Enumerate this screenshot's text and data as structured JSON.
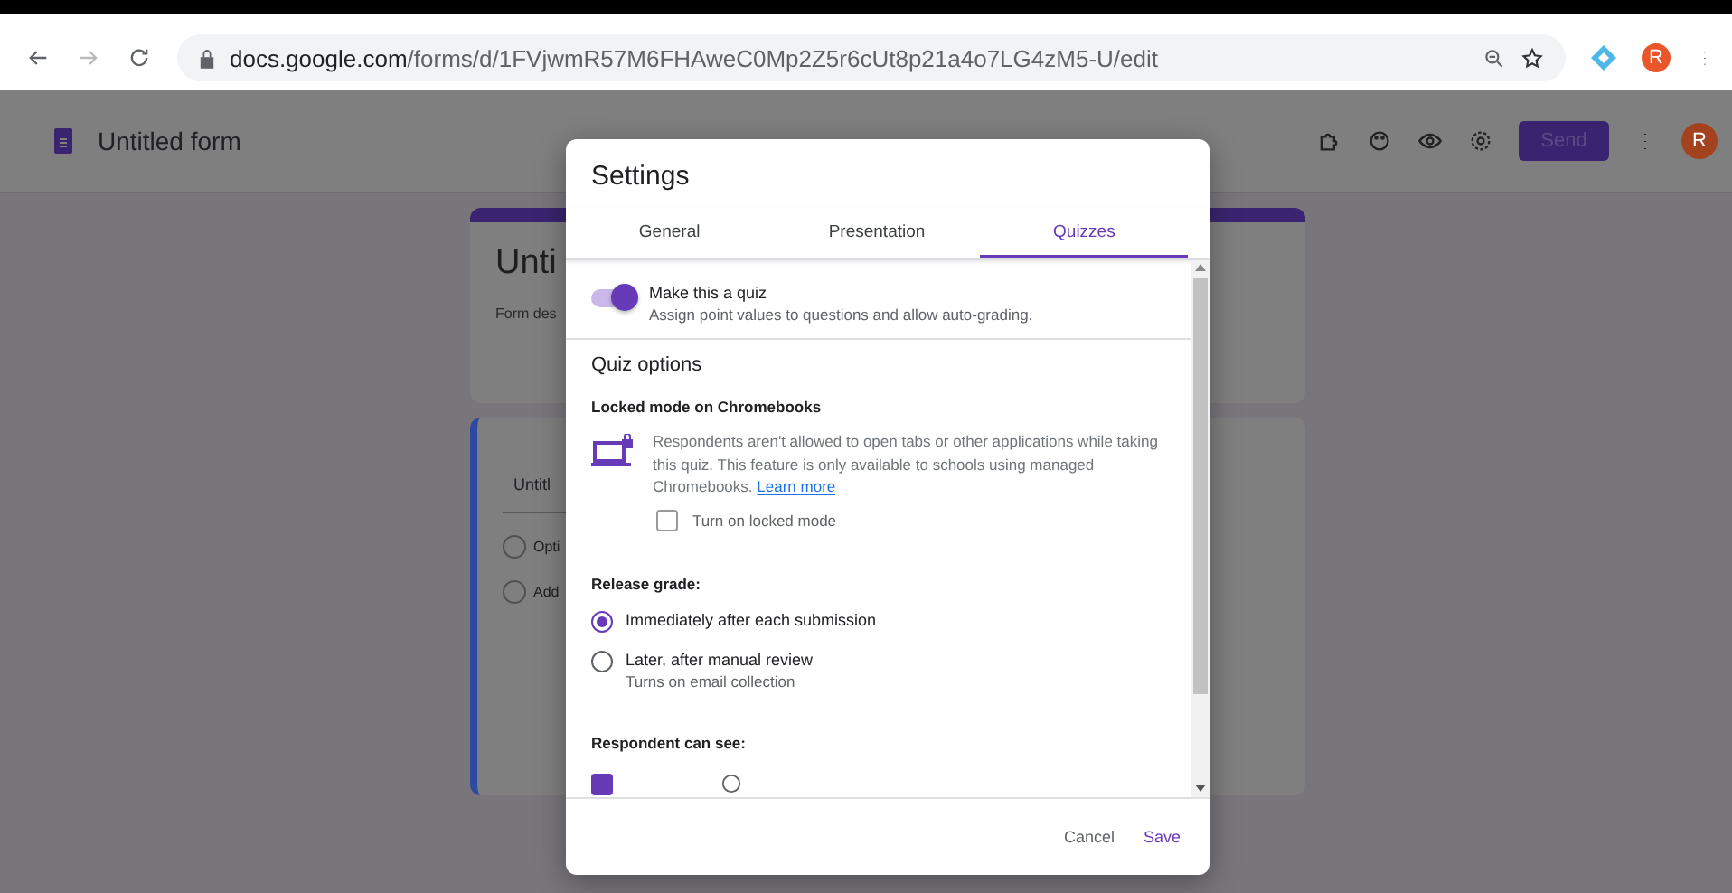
{
  "browser": {
    "url_host": "docs.google.com",
    "url_path": "/forms/d/1FVjwmR57M6FHAweC0Mp2Z5r6cUt8p21a4o7LG4zM5-U/edit",
    "profile_initial": "R"
  },
  "app": {
    "title": "Untitled form",
    "send": "Send",
    "avatar": "R"
  },
  "form": {
    "title": "Unti",
    "description": "Form des",
    "question": "Untitl",
    "options": [
      {
        "label": "Opti"
      },
      {
        "label": "Add"
      }
    ]
  },
  "settings": {
    "title": "Settings",
    "tabs": [
      {
        "label": "General",
        "selected": false
      },
      {
        "label": "Presentation",
        "selected": false
      },
      {
        "label": "Quizzes",
        "selected": true
      }
    ],
    "quiz_toggle": {
      "label": "Make this a quiz",
      "description": "Assign point values to questions and allow auto-grading.",
      "on": true
    },
    "section": "Quiz options",
    "locked": {
      "heading": "Locked mode on Chromebooks",
      "text": "Respondents aren't allowed to open tabs or other applications while taking this quiz. This feature is only available to schools using managed Chromebooks.",
      "link": "Learn more",
      "checkbox": {
        "label": "Turn on locked mode",
        "checked": false
      }
    },
    "release": {
      "heading": "Release grade:",
      "options": [
        {
          "label": "Immediately after each submission",
          "selected": true
        },
        {
          "label": "Later, after manual review",
          "sublabel": "Turns on email collection",
          "selected": false
        }
      ]
    },
    "respondent": {
      "heading": "Respondent can see:",
      "items": [
        {
          "checked": true
        }
      ]
    },
    "buttons": {
      "cancel": "Cancel",
      "save": "Save"
    }
  }
}
